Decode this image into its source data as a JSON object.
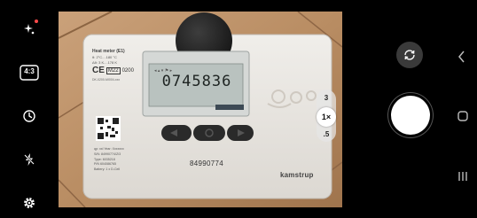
{
  "camera": {
    "aspect_ratio_label": "4:3",
    "zoom_levels": [
      "3",
      "1×",
      ".5"
    ],
    "active_zoom": "1×"
  },
  "meter": {
    "title": "Heat meter (E1)",
    "range_line1": "θ: 2°C....180 °C",
    "range_line2": "Δθ: 3 K....178 K",
    "ce_mark": "CE",
    "mark_code": "M22",
    "mark_number": "0200",
    "serial_line": "DK-0200-MI004-xxx",
    "reading": "0745836",
    "meter_number": "84990774",
    "brand": "kamstrup",
    "info_lines": [
      "qp: xxl Year: Xxxxxxx",
      "S/N: 84990774/Z/3",
      "Type: 6035218",
      "P/N 604086765",
      "Battery: 1 x D-Cell"
    ]
  },
  "colors": {
    "accent_dot": "#ff4a4a",
    "meter_body": "#e9e6e1",
    "lcd": "#b9c2bf"
  }
}
